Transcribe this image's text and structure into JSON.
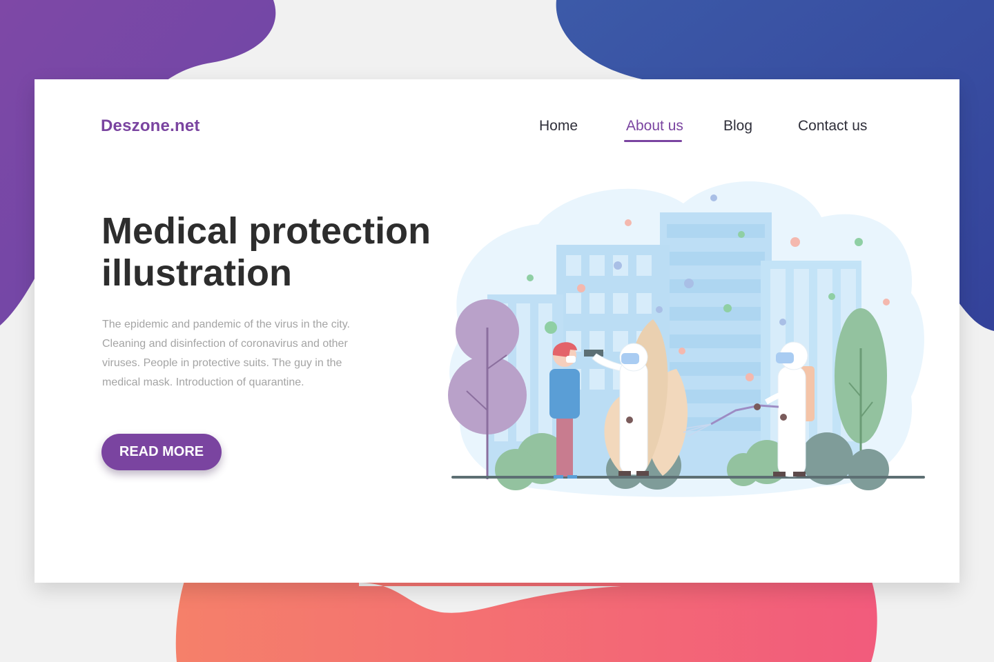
{
  "brand": {
    "name": "Deszone.net",
    "color": "#7a44a0"
  },
  "nav": {
    "items": [
      {
        "label": "Home",
        "active": false
      },
      {
        "label": "About us",
        "active": true
      },
      {
        "label": "Blog",
        "active": false
      },
      {
        "label": "Contact us",
        "active": false
      }
    ]
  },
  "hero": {
    "title": "Medical protection illustration",
    "description": "The epidemic and pandemic of the virus in the city. Cleaning and disinfection of coronavirus and other viruses. People in protective suits. The guy in the medical mask. Introduction of quarantine.",
    "cta_label": "READ MORE"
  },
  "colors": {
    "accent": "#7a44a0",
    "blob_top_left": "#7a46a4",
    "blob_top_right": "#3b4fa0",
    "blob_bottom": "#f47e6b",
    "heading": "#2d2d2d",
    "body_text": "#a4a4a4"
  },
  "illustration": {
    "subject": "city with buildings, trees, a man in a medical mask, two workers in protective suits measuring temperature and disinfecting"
  }
}
